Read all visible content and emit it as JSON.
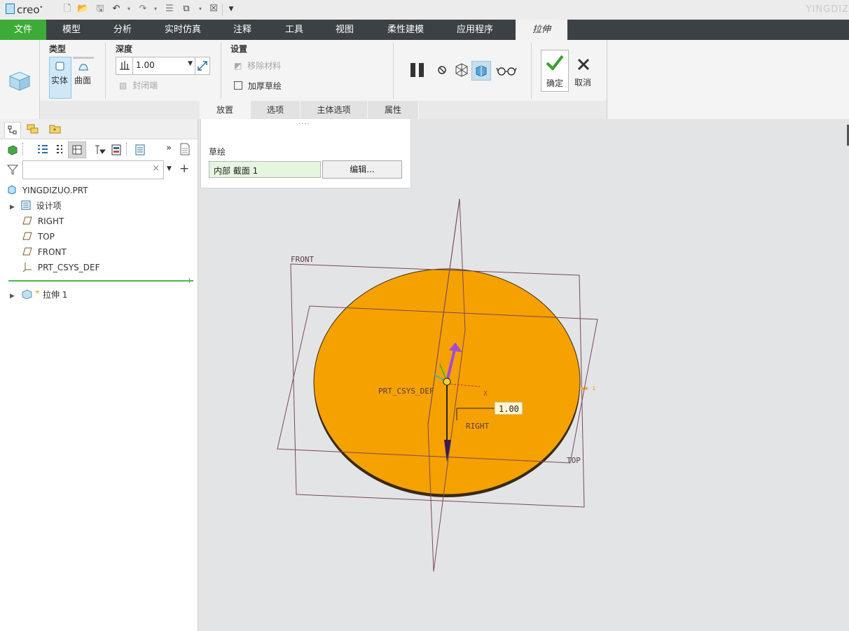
{
  "qab": {
    "logo": "creo",
    "brand": "YINGDIZ"
  },
  "menu": {
    "tabs": [
      "文件",
      "模型",
      "分析",
      "实时仿真",
      "注释",
      "工具",
      "视图",
      "柔性建模",
      "应用程序",
      "拉伸"
    ]
  },
  "ribbon": {
    "type": {
      "title": "类型",
      "solid": "实体",
      "surface": "曲面"
    },
    "depth": {
      "title": "深度",
      "value": "1.00",
      "capped": "封闭端"
    },
    "settings": {
      "title": "设置",
      "remove_material": "移除材料",
      "thicken_sketch": "加厚草绘"
    },
    "ok": "确定",
    "cancel": "取消",
    "dash_tabs": [
      "放置",
      "选项",
      "主体选项",
      "属性"
    ]
  },
  "placement": {
    "dots": "····",
    "label": "草绘",
    "section": "内部 截面 1",
    "edit": "编辑..."
  },
  "tree": {
    "search_placeholder": "",
    "root": "YINGDIZUO.PRT",
    "items": [
      "设计项",
      "RIGHT",
      "TOP",
      "FRONT",
      "PRT_CSYS_DEF"
    ],
    "feature": "拉伸 1"
  },
  "viewport": {
    "labels": {
      "front": "FRONT",
      "right": "RIGHT",
      "top": "TOP",
      "csys": "PRT_CSYS_DEF",
      "x_axis": "X",
      "dim": "1.00"
    },
    "colors": {
      "body": "#f5a100",
      "datum": "#7a4a58",
      "arrow": "#a44bd6"
    }
  }
}
